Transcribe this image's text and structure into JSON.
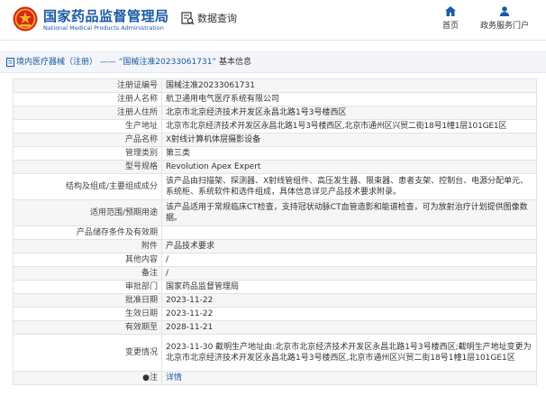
{
  "header": {
    "title": "国家药品监督管理局",
    "subtitle": "National Medical Products Administration",
    "data_query": "数据查询",
    "nav": [
      {
        "label": "首页",
        "icon": "home-icon"
      },
      {
        "label": "政务服务门户",
        "icon": "user-icon"
      }
    ]
  },
  "breadcrumb": {
    "category": "境内医疗器械（注册）",
    "separator": "——",
    "record": "“国械注准20233061731”",
    "section": "基本信息"
  },
  "detail": {
    "rows": [
      {
        "label": "注册证编号",
        "value": "国械注准20233061731"
      },
      {
        "label": "注册人名称",
        "value": "航卫通用电气医疗系统有限公司"
      },
      {
        "label": "注册人住所",
        "value": "北京市北京经济技术开发区永昌北路1号3号楼西区"
      },
      {
        "label": "生产地址",
        "value": "北京市北京经济技术开发区永昌北路1号3号楼西区,北京市通州区兴贸二街18号1幢1层101GE1区"
      },
      {
        "label": "产品名称",
        "value": "X射线计算机体层摄影设备"
      },
      {
        "label": "管理类别",
        "value": "第三类"
      },
      {
        "label": "型号规格",
        "value": "Revolution Apex Expert"
      },
      {
        "label": "结构及组成/主要组成成分",
        "value": "该产品由扫描架、探测器、X射线管组件、高压发生器、限束器、患者支架、控制台、电源分配单元、系统柜、系统软件和选件组成，具体信息详见产品技术要求附录。"
      },
      {
        "label": "适用范围/预期用途",
        "value": "该产品适用于常规临床CT检查，支持冠状动脉CT血管造影和能谱检查，可为放射治疗计划提供图像数据。"
      },
      {
        "label": "产品储存条件及有效期",
        "value": ""
      },
      {
        "label": "附件",
        "value": "产品技术要求"
      },
      {
        "label": "其他内容",
        "value": "/"
      },
      {
        "label": "备注",
        "value": "/"
      },
      {
        "label": "审批部门",
        "value": "国家药品监督管理局"
      },
      {
        "label": "批准日期",
        "value": "2023-11-22"
      },
      {
        "label": "生效日期",
        "value": "2023-11-22"
      },
      {
        "label": "有效期至",
        "value": "2028-11-21"
      },
      {
        "label": "变更情况",
        "value": "2023-11-30 截明生产地址由:北京市北京经济技术开发区永昌北路1号3号楼西区;截明生产地址变更为北京市北京经济技术开发区永昌北路1号3号楼西区,北京市通州区兴贸二街18号1幢1层101GE1区"
      },
      {
        "label": "注",
        "star": "●",
        "value": "详情"
      }
    ]
  },
  "colors": {
    "brand_blue": "#1b5aa6",
    "logo_red": "#d7261e",
    "logo_gold": "#f2b51c",
    "row_alt": "#f6f6f6"
  }
}
